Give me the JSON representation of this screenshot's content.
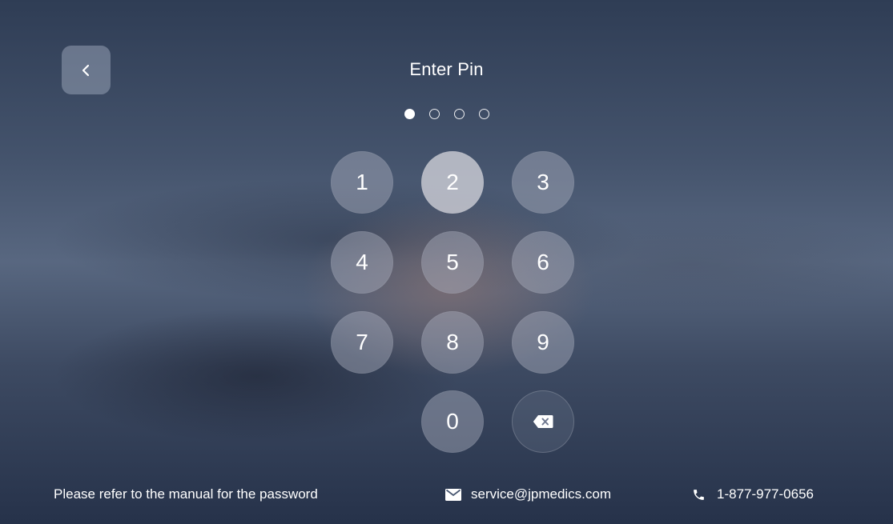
{
  "title": "Enter Pin",
  "pin": {
    "length": 4,
    "entered": 1
  },
  "keypad": {
    "keys": [
      "1",
      "2",
      "3",
      "4",
      "5",
      "6",
      "7",
      "8",
      "9",
      "0"
    ],
    "pressed_key": "2",
    "delete_icon": "backspace-icon"
  },
  "back_icon": "chevron-left-icon",
  "footer": {
    "note": "Please refer to the manual for the password",
    "email": "service@jpmedics.com",
    "email_icon": "envelope-icon",
    "phone": "1-877-977-0656",
    "phone_icon": "phone-icon"
  },
  "colors": {
    "text": "#ffffff",
    "key_background": "#aab0c0",
    "pressed_key_background": "#d7d7de"
  }
}
